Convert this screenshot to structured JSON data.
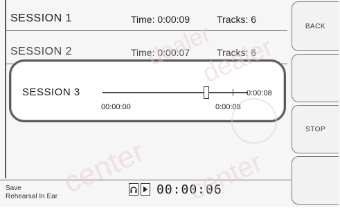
{
  "sessions": [
    {
      "name": "SESSION 1",
      "time": "Time: 0:00:09",
      "tracks": "Tracks: 6"
    },
    {
      "name": "SESSION 2",
      "time": "Time: 0:00:07",
      "tracks": "Tracks: 6"
    }
  ],
  "overlay": {
    "name": "SESSION 3",
    "start": "00:00:00",
    "current": "0:00:08",
    "total": "0:00:08",
    "progress": 0.8
  },
  "buttons": {
    "back": "BACK",
    "stop": "STOP"
  },
  "footer": {
    "line1": "Save",
    "line2": "Rehearsal In Ear",
    "clock": "00:00:06"
  },
  "colors": {
    "background": "#f6f6f6",
    "border": "#5a5a5a",
    "watermark": "#e9c9c9"
  },
  "icons": [
    "headphone-icon",
    "play-icon"
  ]
}
